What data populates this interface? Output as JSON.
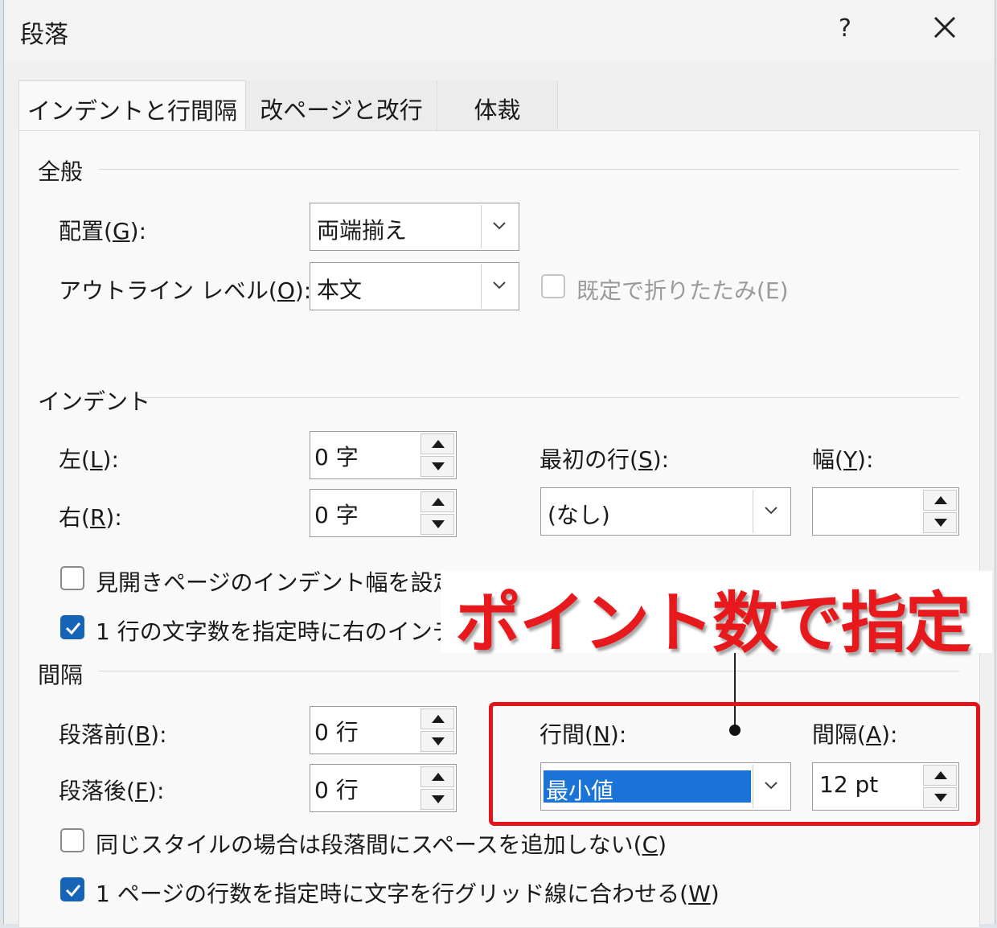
{
  "dialog": {
    "title": "段落",
    "help": "?"
  },
  "tabs": [
    "インデントと行間隔",
    "改ページと改行",
    "体裁"
  ],
  "general": {
    "heading": "全般",
    "alignment_label": "配置(",
    "alignment_key": "G",
    "alignment_suffix": "):",
    "alignment_value": "両端揃え",
    "outline_label": "アウトライン レベル(",
    "outline_key": "O",
    "outline_suffix": "):",
    "outline_value": "本文",
    "collapse_label": "既定で折りたたみ(E)"
  },
  "indent": {
    "heading": "インデント",
    "left_label": "左(",
    "left_key": "L",
    "left_suffix": "):",
    "left_value": "0 字",
    "right_label": "右(",
    "right_key": "R",
    "right_suffix": "):",
    "right_value": "0 字",
    "first_line_label": "最初の行(",
    "first_line_key": "S",
    "first_line_suffix": "):",
    "first_line_value": "(なし)",
    "width_label": "幅(",
    "width_key": "Y",
    "width_suffix": "):",
    "width_value": "",
    "mirror_label": "見開きページのインデント幅を設定す",
    "mirror_checked": false,
    "auto_adjust_label": "1 行の文字数を指定時に右のインデ",
    "auto_adjust_checked": true
  },
  "spacing": {
    "heading": "間隔",
    "before_label": "段落前(",
    "before_key": "B",
    "before_suffix": "):",
    "before_value": "0 行",
    "after_label": "段落後(",
    "after_key": "F",
    "after_suffix": "):",
    "after_value": "0 行",
    "line_spacing_label": "行間(",
    "line_spacing_key": "N",
    "line_spacing_suffix": "):",
    "line_spacing_value": "最小値",
    "at_label": "間隔(",
    "at_key": "A",
    "at_suffix": "):",
    "at_value": "12 pt",
    "no_space_label": "同じスタイルの場合は段落間にスペースを追加しない(",
    "no_space_key": "C",
    "no_space_suffix": ")",
    "no_space_checked": false,
    "grid_label": "1 ページの行数を指定時に文字を行グリッド線に合わせる(",
    "grid_key": "W",
    "grid_suffix": ")",
    "grid_checked": true
  },
  "annotation": {
    "callout": "ポイント数で指定"
  },
  "colors": {
    "accent": "#1664b8",
    "highlight": "#1a73d6",
    "annotation_red": "#e4141b"
  }
}
